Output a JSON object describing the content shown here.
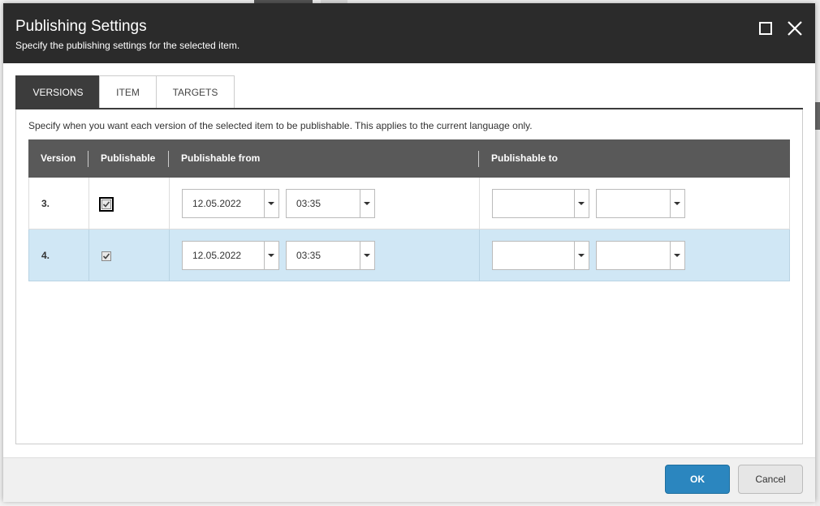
{
  "dialog": {
    "title": "Publishing Settings",
    "subtitle": "Specify the publishing settings for the selected item.",
    "maximize_icon": "maximize-icon",
    "close_icon": "close-icon"
  },
  "tabs": [
    {
      "label": "VERSIONS",
      "active": true
    },
    {
      "label": "ITEM",
      "active": false
    },
    {
      "label": "TARGETS",
      "active": false
    }
  ],
  "panel": {
    "hint": "Specify when you want each version of the selected item to be publishable. This applies to the current language only."
  },
  "grid": {
    "columns": [
      "Version",
      "Publishable",
      "Publishable from",
      "Publishable to"
    ],
    "rows": [
      {
        "version": "3.",
        "publishable": true,
        "from_date": "12.05.2022",
        "from_time": "03:35",
        "to_date": "",
        "to_time": "",
        "selected": false
      },
      {
        "version": "4.",
        "publishable": true,
        "from_date": "12.05.2022",
        "from_time": "03:35",
        "to_date": "",
        "to_time": "",
        "selected": true
      }
    ]
  },
  "footer": {
    "ok_label": "OK",
    "cancel_label": "Cancel"
  },
  "colors": {
    "title_bar": "#2b2b2b",
    "active_tab": "#3c3c3c",
    "grid_header": "#595959",
    "selected_row": "#d0e7f5",
    "primary_button": "#2b86bf"
  }
}
